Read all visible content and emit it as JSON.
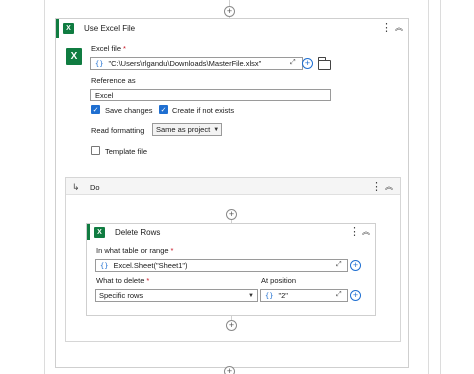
{
  "use_excel": {
    "title": "Use Excel File",
    "excel_file_label": "Excel file",
    "required_mark": "*",
    "excel_file_value": "\"C:\\Users\\rlgandu\\Downloads\\MasterFile.xlsx\"",
    "reference_as_label": "Reference as",
    "reference_as_value": "Excel",
    "save_changes_label": "Save changes",
    "save_changes_checked": true,
    "create_if_not_exists_label": "Create if not exists",
    "create_if_not_exists_checked": true,
    "read_formatting_label": "Read formatting",
    "read_formatting_value": "Same as project",
    "template_file_label": "Template file",
    "template_file_checked": false
  },
  "do_block": {
    "title": "Do"
  },
  "delete_rows": {
    "title": "Delete Rows",
    "table_range_label": "In what table or range",
    "table_range_value": "Excel.Sheet(\"Sheet1\")",
    "what_to_delete_label": "What to delete",
    "what_to_delete_value": "Specific rows",
    "at_position_label": "At position",
    "at_position_value": "\"2\""
  },
  "icons": {
    "brace": "{}",
    "excel": "X",
    "plus": "+",
    "kebab": "⋮",
    "collapse": "︽",
    "expand": "⤢",
    "checkmark": "✓",
    "chevron": "▼",
    "do_arrow": "↳"
  },
  "colors": {
    "excel_green": "#107c41",
    "accent_blue": "#1f6fd1",
    "required_red": "#c50f1f"
  }
}
